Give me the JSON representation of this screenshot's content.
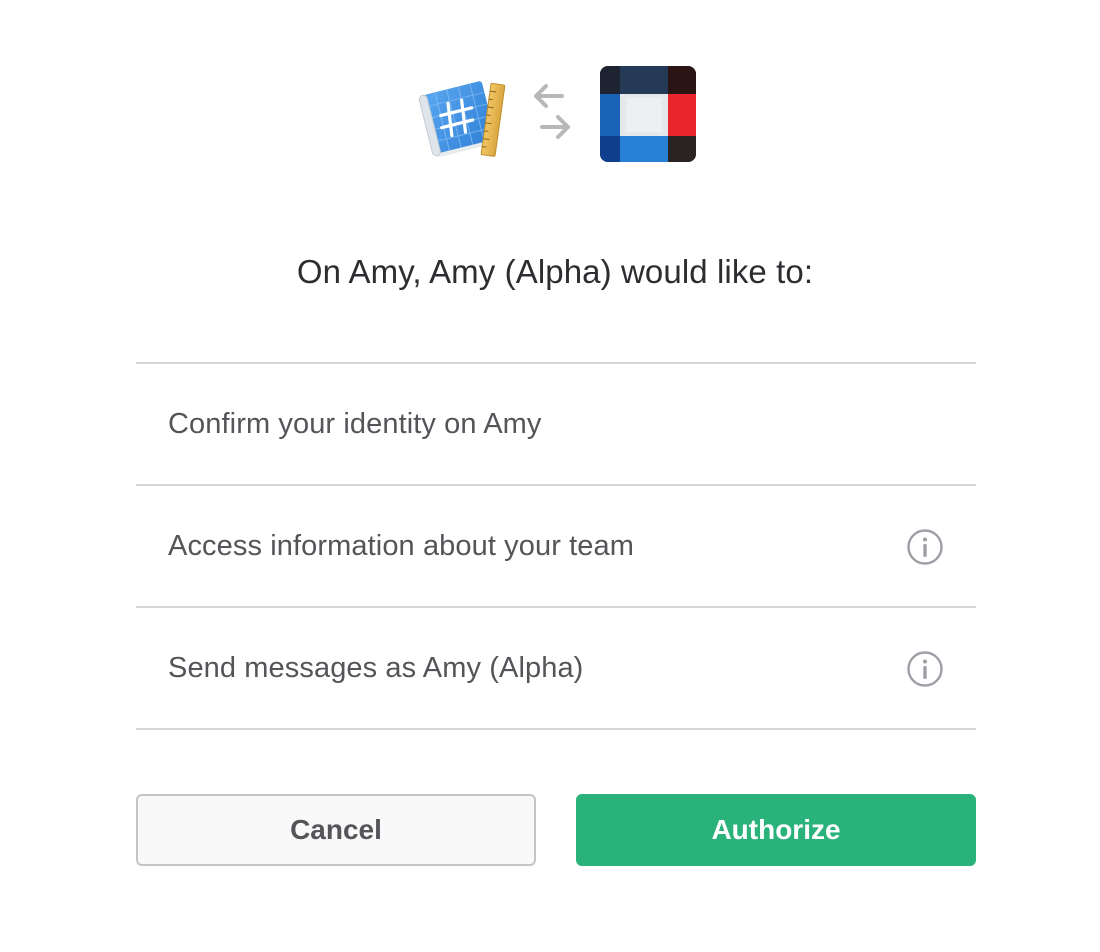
{
  "header": {
    "app_icon": "blueprint-hash-icon",
    "swap_icon": "swap-arrows-icon",
    "team_icon": "team-grid-icon"
  },
  "heading": "On Amy, Amy (Alpha) would like to:",
  "permissions": [
    {
      "label": "Confirm your identity on Amy",
      "has_info": false
    },
    {
      "label": "Access information about your team",
      "has_info": true,
      "icon": "info-icon"
    },
    {
      "label": "Send messages as Amy (Alpha)",
      "has_info": true,
      "icon": "info-icon"
    }
  ],
  "buttons": {
    "cancel_label": "Cancel",
    "authorize_label": "Authorize"
  },
  "colors": {
    "authorize": "#2ab27b",
    "divider": "#d5d5d6",
    "text": "#2c2d30",
    "muted_text": "#555459"
  }
}
